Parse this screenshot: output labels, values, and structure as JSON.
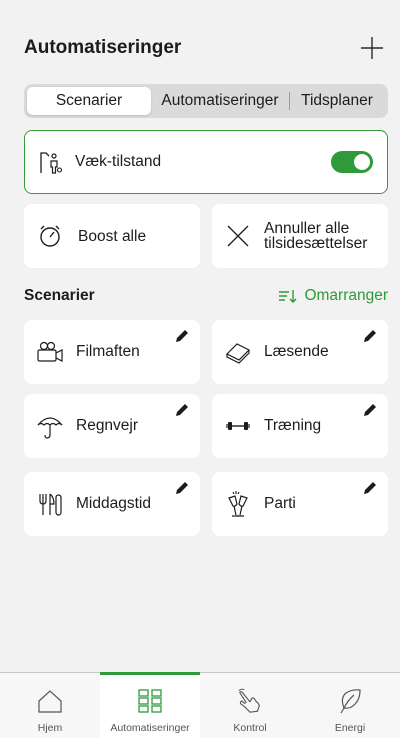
{
  "header": {
    "title": "Automatiseringer"
  },
  "tabs": [
    {
      "label": "Scenarier",
      "active": true
    },
    {
      "label": "Automatiseringer",
      "active": false
    },
    {
      "label": "Tidsplaner",
      "active": false
    }
  ],
  "away_mode": {
    "label": "Væk-tilstand",
    "enabled": true
  },
  "actions": {
    "boost_label": "Boost alle",
    "cancel_line1": "Annuller alle",
    "cancel_line2": "tilsidesættelser"
  },
  "section": {
    "title": "Scenarier",
    "reorder_label": "Omarranger"
  },
  "scenes": [
    {
      "label": "Filmaften",
      "icon": "film-camera-icon"
    },
    {
      "label": "Læsende",
      "icon": "book-icon"
    },
    {
      "label": "Regnvejr",
      "icon": "umbrella-icon"
    },
    {
      "label": "Træning",
      "icon": "dumbbell-icon"
    },
    {
      "label": "Middagstid",
      "icon": "cutlery-icon"
    },
    {
      "label": "Parti",
      "icon": "champagne-glasses-icon"
    }
  ],
  "nav": [
    {
      "label": "Hjem",
      "icon": "home-icon",
      "active": false
    },
    {
      "label": "Automatiseringer",
      "icon": "grid-icon",
      "active": true
    },
    {
      "label": "Kontrol",
      "icon": "hand-touch-icon",
      "active": false
    },
    {
      "label": "Energi",
      "icon": "leaf-icon",
      "active": false
    }
  ],
  "colors": {
    "accent": "#2f9a3a",
    "background": "#f2f2f2",
    "card": "#ffffff"
  }
}
